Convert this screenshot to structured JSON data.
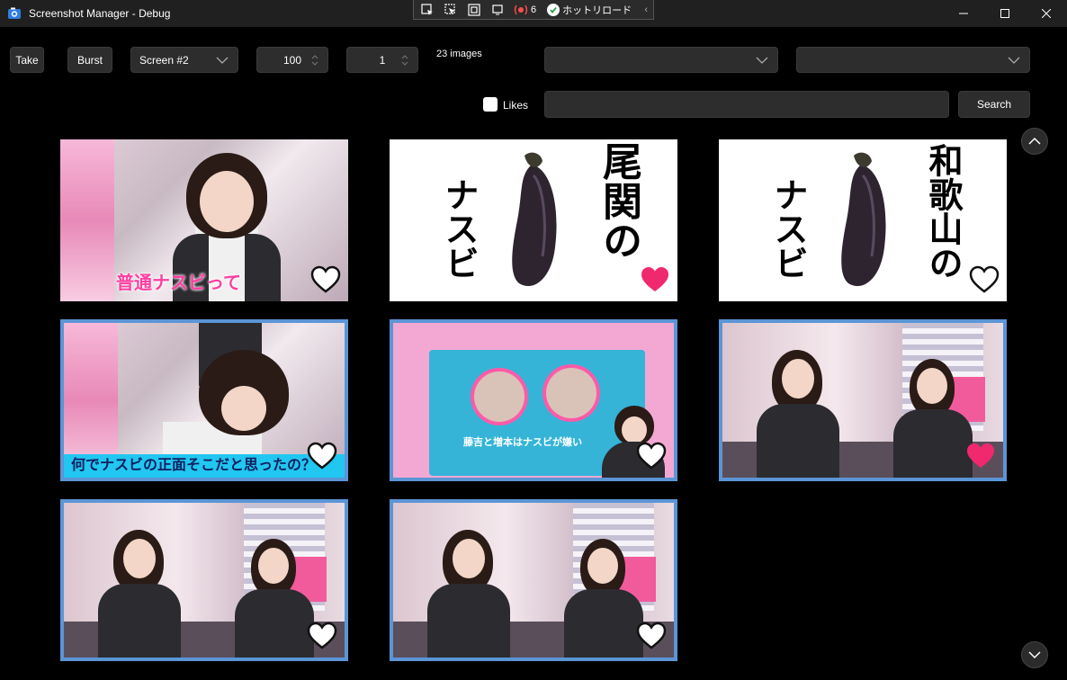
{
  "window": {
    "title": "Screenshot Manager - Debug",
    "debug_count": "6",
    "hot_reload_label": "ホットリロード"
  },
  "toolbar": {
    "take_label": "Take",
    "burst_label": "Burst",
    "screen_selected": "Screen #2",
    "quality_value": "100",
    "interval_value": "1",
    "image_count": "23 images",
    "filter1_value": "",
    "filter2_value": ""
  },
  "search": {
    "likes_label": "Likes",
    "query": "",
    "search_label": "Search"
  },
  "thumbnails": [
    {
      "caption": "普通ナスビって",
      "liked": false,
      "selected": false
    },
    {
      "caption_left": "ナスビ",
      "caption_right": "尾関の",
      "liked": true,
      "selected": false
    },
    {
      "caption_left": "ナスビ",
      "caption_right": "和歌山の",
      "liked": false,
      "selected": false
    },
    {
      "caption": "何でナスビの正面そこだと思ったの？",
      "liked": false,
      "selected": true
    },
    {
      "caption": "藤吉と増本はナスビが嫌い",
      "liked": false,
      "selected": true
    },
    {
      "caption": "",
      "liked": true,
      "selected": true
    },
    {
      "caption": "",
      "liked": false,
      "selected": true
    },
    {
      "caption": "",
      "liked": false,
      "selected": true
    }
  ],
  "colors": {
    "background": "#000000",
    "titlebar": "#202020",
    "control": "#2d2d2d",
    "selection_border": "#5b95d6",
    "heart_liked": "#f0286e",
    "heart_outline": "#111111"
  }
}
